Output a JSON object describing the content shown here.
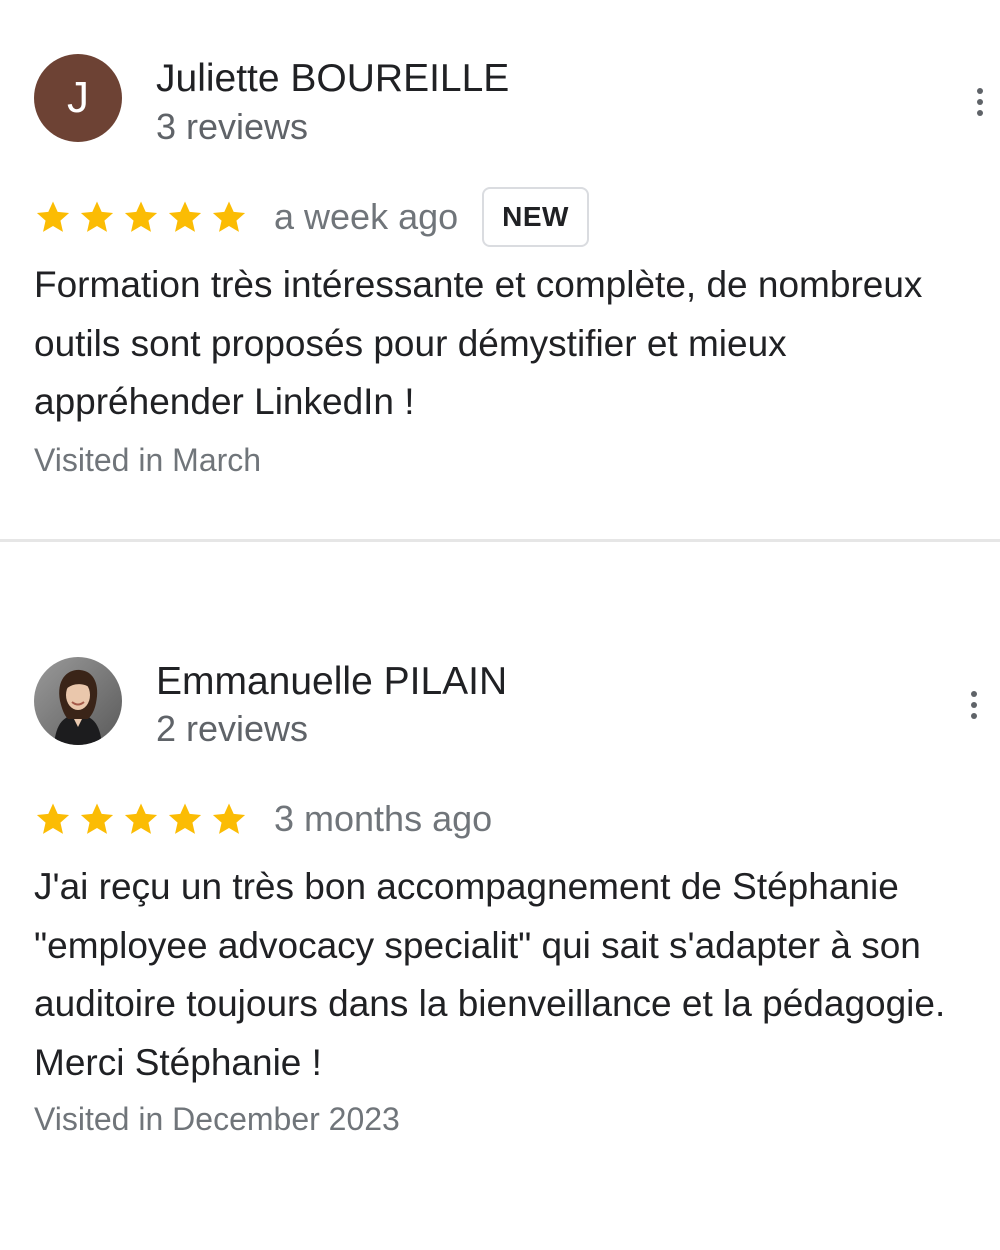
{
  "colors": {
    "star": "#fbbc04",
    "avatar_bg": "#6d4234",
    "divider": "#e6e6e6"
  },
  "reviews": [
    {
      "avatar_letter": "J",
      "name": "Juliette BOUREILLE",
      "review_count": "3 reviews",
      "rating": 5,
      "date": "a week ago",
      "badge": "NEW",
      "text": "Formation très intéressante et complète, de nombreux outils sont proposés pour démystifier et mieux appréhender LinkedIn !",
      "visited": "Visited in March"
    },
    {
      "avatar_icon": "profile-photo",
      "name": "Emmanuelle PILAIN",
      "review_count": "2 reviews",
      "rating": 5,
      "date": "3 months ago",
      "text": "J'ai reçu un très bon accompagnement de Stéphanie \"employee advocacy specialit\" qui sait s'adapter à son auditoire toujours dans la bienveillance et la pédagogie. Merci Stéphanie !",
      "visited": "Visited in December 2023"
    }
  ]
}
